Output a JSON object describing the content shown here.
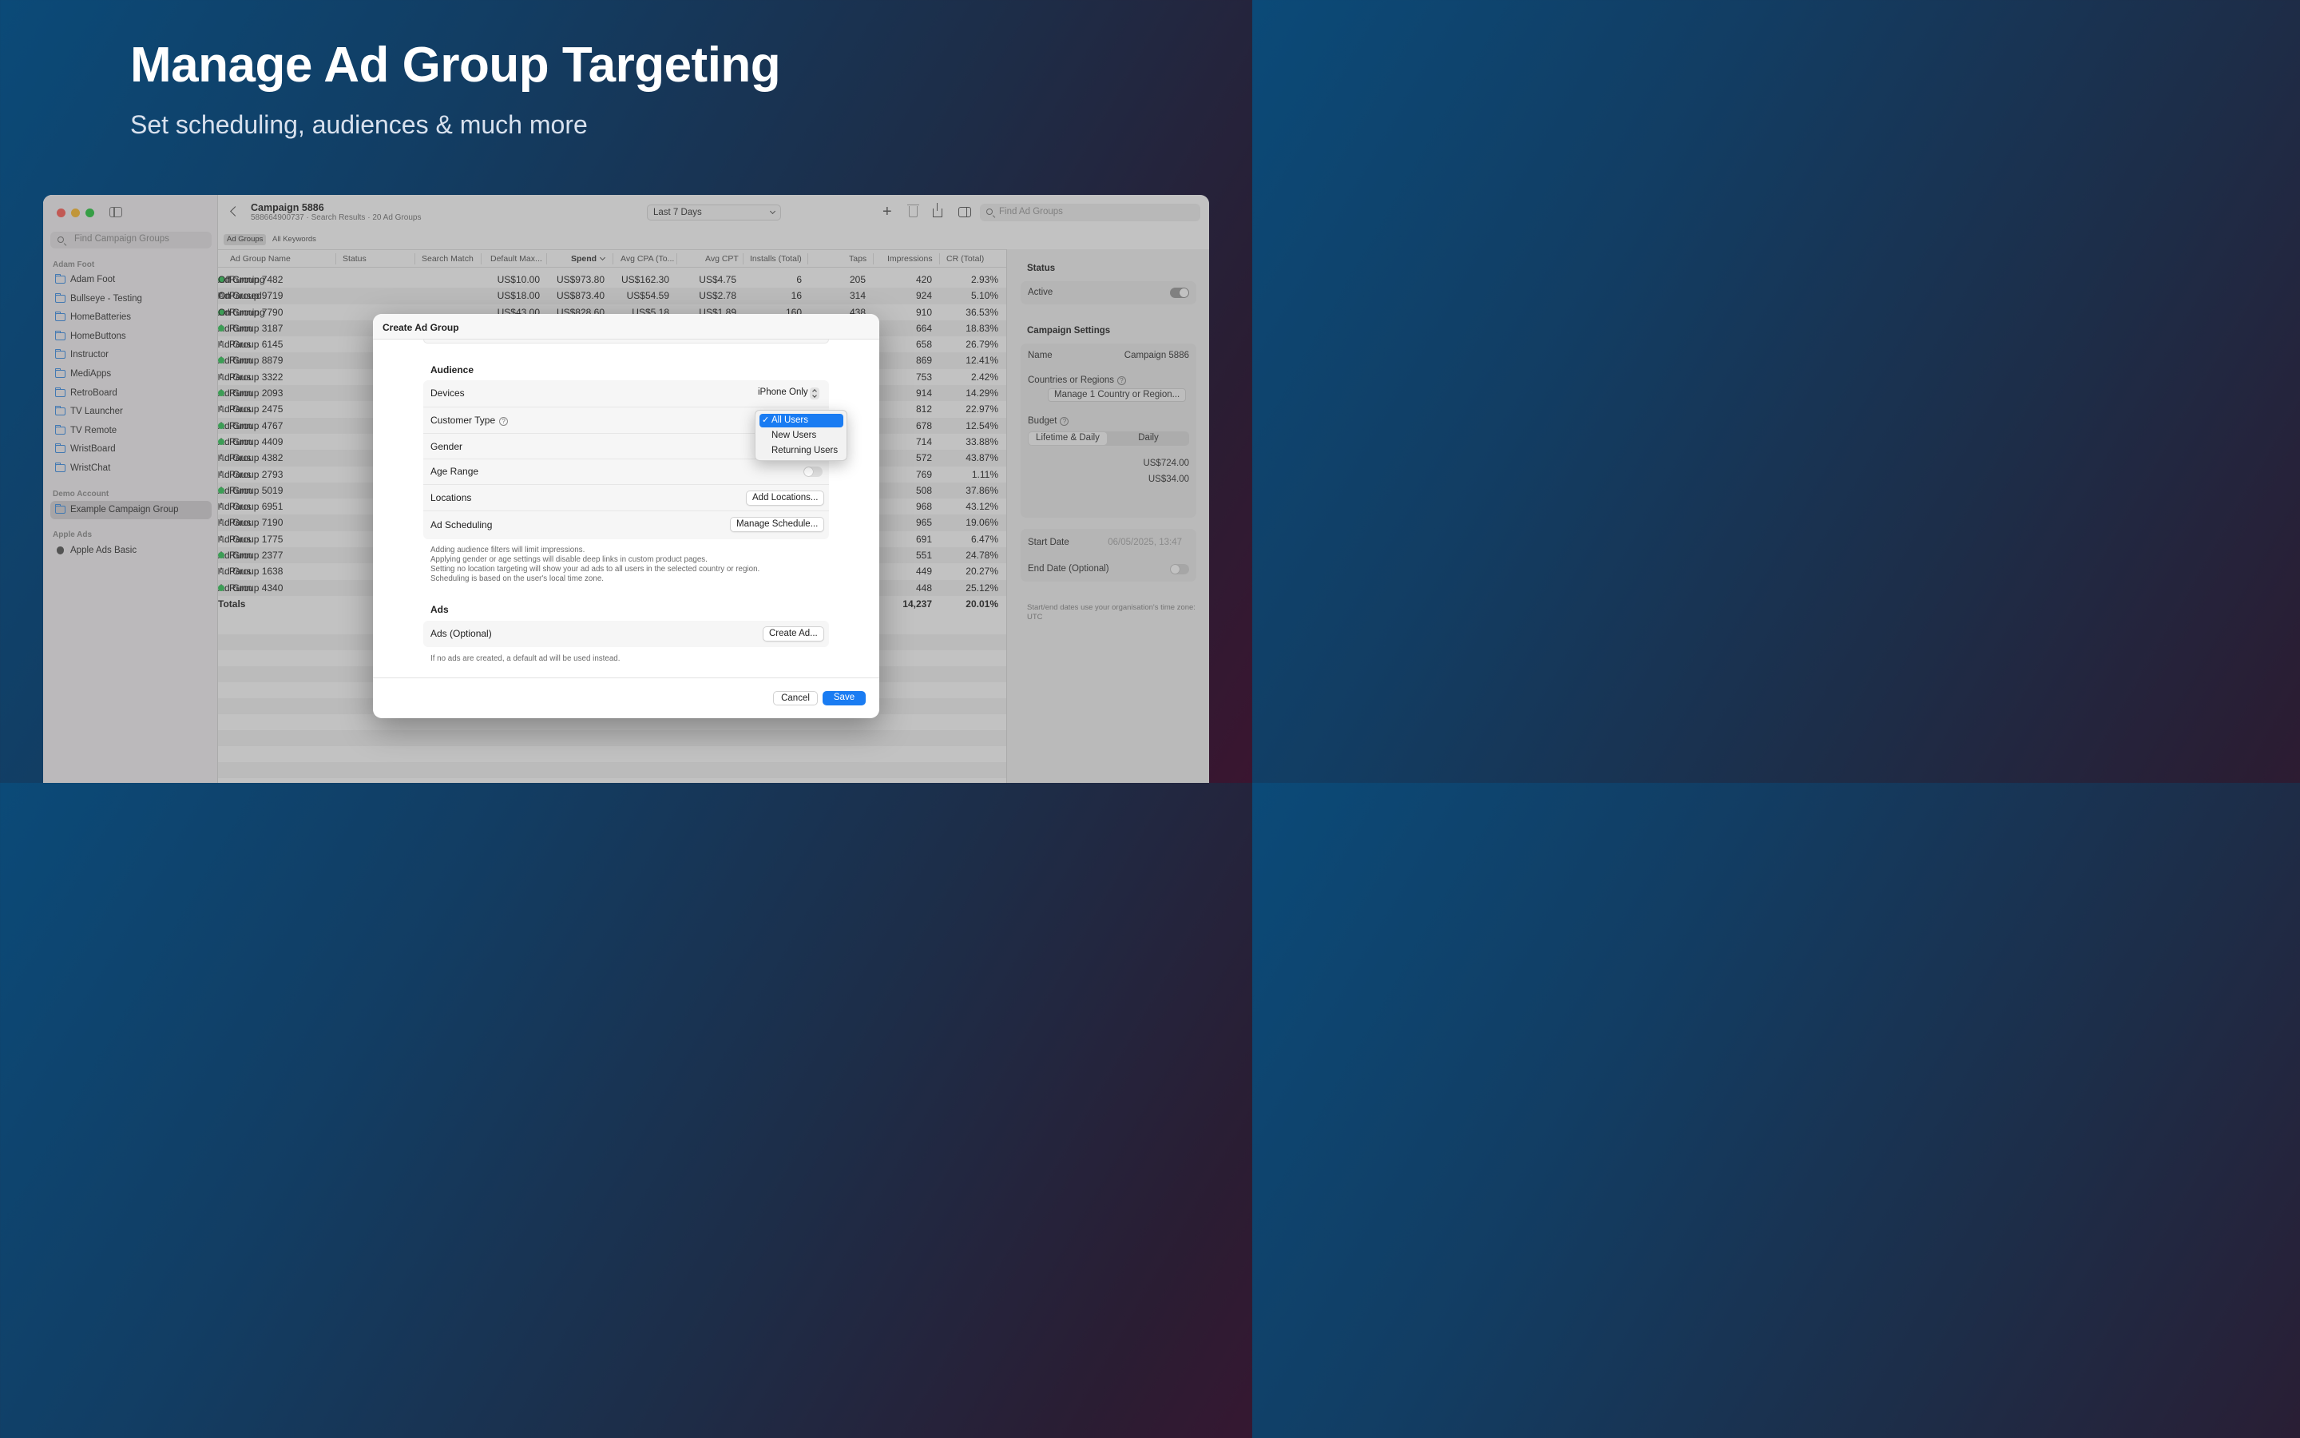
{
  "hero": {
    "title": "Manage Ad Group Targeting",
    "subtitle": "Set scheduling, audiences & much more"
  },
  "sidebar": {
    "search_placeholder": "Find Campaign Groups",
    "sections": {
      "adam_foot": "Adam Foot",
      "demo_account": "Demo Account",
      "apple_ads": "Apple Ads"
    },
    "adam_foot_items": [
      "Adam Foot",
      "Bullseye - Testing",
      "HomeBatteries",
      "HomeButtons",
      "Instructor",
      "MediApps",
      "RetroBoard",
      "TV Launcher",
      "TV Remote",
      "WristBoard",
      "WristChat"
    ],
    "demo_items": [
      "Example Campaign Group"
    ],
    "apple_items": [
      "Apple Ads Basic"
    ]
  },
  "toolbar": {
    "campaign_title": "Campaign 5886",
    "campaign_subtitle": "588664900737 · Search Results · 20 Ad Groups",
    "date_range": "Last 7 Days",
    "plus_glyph": "+",
    "search_placeholder": "Find Ad Groups"
  },
  "tabs": {
    "ad_groups": "Ad Groups",
    "all_keywords": "All Keywords"
  },
  "table": {
    "headers": {
      "name": "Ad Group Name",
      "status": "Status",
      "match": "Search Match",
      "max": "Default Max...",
      "spend": "Spend",
      "cpa": "Avg CPA (To...",
      "cpt": "Avg CPT",
      "installs": "Installs (Total)",
      "taps": "Taps",
      "impressions": "Impressions",
      "cr": "CR (Total)"
    },
    "rows": [
      {
        "name": "Ad Group 7482",
        "status": "Running",
        "match": "Off",
        "max": "US$10.00",
        "spend": "US$973.80",
        "cpa": "US$162.30",
        "cpt": "US$4.75",
        "installs": "6",
        "taps": "205",
        "impressions": "420",
        "cr": "2.93%"
      },
      {
        "name": "Ad Group 9719",
        "status": "Paused",
        "match": "On",
        "max": "US$18.00",
        "spend": "US$873.40",
        "cpa": "US$54.59",
        "cpt": "US$2.78",
        "installs": "16",
        "taps": "314",
        "impressions": "924",
        "cr": "5.10%"
      },
      {
        "name": "Ad Group 7790",
        "status": "Running",
        "match": "On",
        "max": "US$43.00",
        "spend": "US$828.60",
        "cpa": "US$5.18",
        "cpt": "US$1.89",
        "installs": "160",
        "taps": "438",
        "impressions": "910",
        "cr": "36.53%"
      },
      {
        "name": "Ad Group 3187",
        "status": "Runn",
        "impressions": "664",
        "cr": "18.83%"
      },
      {
        "name": "Ad Group 6145",
        "status": "Paus",
        "impressions": "658",
        "cr": "26.79%"
      },
      {
        "name": "Ad Group 8879",
        "status": "Runn",
        "impressions": "869",
        "cr": "12.41%"
      },
      {
        "name": "Ad Group 3322",
        "status": "Paus",
        "impressions": "753",
        "cr": "2.42%"
      },
      {
        "name": "Ad Group 2093",
        "status": "Runn",
        "impressions": "914",
        "cr": "14.29%"
      },
      {
        "name": "Ad Group 2475",
        "status": "Paus",
        "impressions": "812",
        "cr": "22.97%"
      },
      {
        "name": "Ad Group 4767",
        "status": "Runn",
        "impressions": "678",
        "cr": "12.54%"
      },
      {
        "name": "Ad Group 4409",
        "status": "Runn",
        "impressions": "714",
        "cr": "33.88%"
      },
      {
        "name": "Ad Group 4382",
        "status": "Paus",
        "impressions": "572",
        "cr": "43.87%"
      },
      {
        "name": "Ad Group 2793",
        "status": "Paus",
        "impressions": "769",
        "cr": "1.11%"
      },
      {
        "name": "Ad Group 5019",
        "status": "Runn",
        "impressions": "508",
        "cr": "37.86%"
      },
      {
        "name": "Ad Group 6951",
        "status": "Paus",
        "impressions": "968",
        "cr": "43.12%"
      },
      {
        "name": "Ad Group 7190",
        "status": "Paus",
        "impressions": "965",
        "cr": "19.06%"
      },
      {
        "name": "Ad Group 1775",
        "status": "Paus",
        "impressions": "691",
        "cr": "6.47%"
      },
      {
        "name": "Ad Group 2377",
        "status": "Runn",
        "impressions": "551",
        "cr": "24.78%"
      },
      {
        "name": "Ad Group 1638",
        "status": "Paus",
        "impressions": "449",
        "cr": "20.27%"
      },
      {
        "name": "Ad Group 4340",
        "status": "Runn",
        "impressions": "448",
        "cr": "25.12%"
      }
    ],
    "totals": {
      "name": "Totals",
      "impressions": "14,237",
      "cr": "20.01%"
    }
  },
  "inspector": {
    "status_heading": "Status",
    "active_label": "Active",
    "settings_heading": "Campaign Settings",
    "name_label": "Name",
    "name_value": "Campaign 5886",
    "countries_label": "Countries or Regions",
    "countries_button": "Manage 1 Country or Region...",
    "budget_label": "Budget",
    "budget_seg_on": "Lifetime & Daily",
    "budget_seg_off": "Daily",
    "budget_lifetime": "US$724.00",
    "budget_daily": "US$34.00",
    "start_label": "Start Date",
    "start_value": "06/05/2025, 13:47",
    "end_label": "End Date (Optional)",
    "note": "Start/end dates use your organisation's time zone: UTC",
    "help_glyph": "?"
  },
  "modal": {
    "title": "Create Ad Group",
    "audience_heading": "Audience",
    "devices_label": "Devices",
    "devices_value": "iPhone Only",
    "customer_type_label": "Customer Type",
    "gender_label": "Gender",
    "age_label": "Age Range",
    "locations_label": "Locations",
    "locations_button": "Add Locations...",
    "scheduling_label": "Ad Scheduling",
    "scheduling_button": "Manage Schedule...",
    "notes": [
      "Adding audience filters will limit impressions.",
      "Applying gender or age settings will disable deep links in custom product pages.",
      "Setting no location targeting will show your ad ads to all users in the selected country or region.",
      "Scheduling is based on the user's local time zone."
    ],
    "ads_heading": "Ads",
    "ads_label": "Ads (Optional)",
    "ads_button": "Create Ad...",
    "ads_note": "If no ads are created, a default ad will be used instead.",
    "cancel": "Cancel",
    "save": "Save"
  },
  "customer_type_menu": {
    "items": [
      "All Users",
      "New Users",
      "Returning Users"
    ],
    "selected": "All Users",
    "check_glyph": "✓"
  },
  "colors": {
    "accent": "#1a7cf2",
    "running": "#34c759",
    "paused": "#9a9a9a",
    "traffic_red": "#ff5f57",
    "traffic_yellow": "#febc2e",
    "traffic_green": "#28c840"
  }
}
